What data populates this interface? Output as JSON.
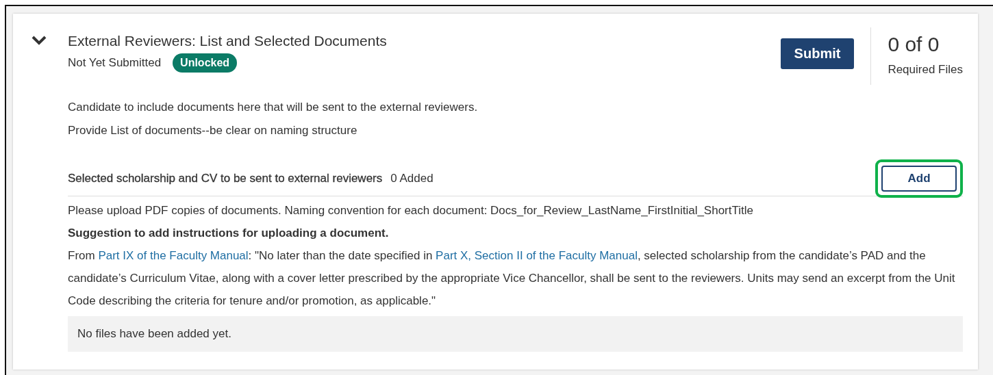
{
  "section": {
    "expanded": true,
    "title": "External Reviewers: List and Selected Documents",
    "status": "Not Yet Submitted",
    "badge": "Unlocked",
    "submit_button": "Submit",
    "required_count": "0 of 0",
    "required_label": "Required Files",
    "description": [
      "Candidate to include documents here that will be sent to the external reviewers.",
      "Provide List of documents--be clear on naming structure"
    ]
  },
  "requirement": {
    "title": "Selected scholarship and CV to be sent to external reviewers",
    "count": "0 Added",
    "add_button": "Add",
    "add_highlighted": true,
    "instructions": "Please upload PDF copies of documents. Naming convention for each document: Docs_for_Review_LastName_FirstInitial_ShortTitle",
    "suggestion": "Suggestion to add instructions for uploading a document.",
    "quote": [
      {
        "kind": "text",
        "text": "From "
      },
      {
        "kind": "link",
        "text": "Part IX of the Faculty Manual"
      },
      {
        "kind": "text",
        "text": ": \"No later than the date specified in "
      },
      {
        "kind": "link",
        "text": "Part X, Section II of the Faculty Manual"
      },
      {
        "kind": "text",
        "text": ", selected scholarship from the candidate’s PAD and the candidate’s Curriculum Vitae, along with a cover letter prescribed by the appropriate Vice Chancellor, shall be sent to the reviewers. Units may send an excerpt from the Unit Code describing the criteria for tenure and/or promotion, as applicable.\""
      }
    ],
    "empty_message": "No files have been added yet."
  }
}
